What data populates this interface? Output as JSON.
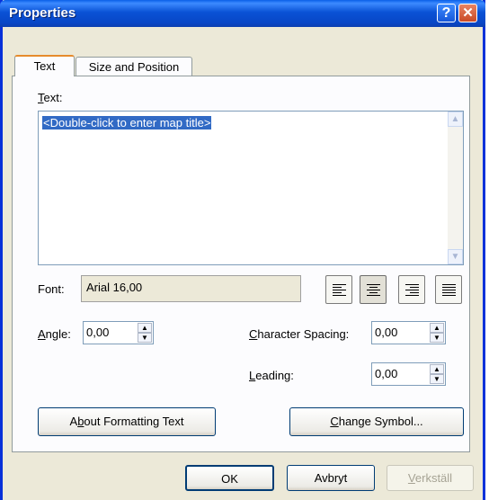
{
  "window": {
    "title": "Properties",
    "help_glyph": "?",
    "close_glyph": "✕"
  },
  "tabs": [
    {
      "label": "Text"
    },
    {
      "label": "Size and Position"
    }
  ],
  "text_section": {
    "label_underlined": "T",
    "label_rest": "ext:",
    "content": "<Double-click to enter map title>"
  },
  "font": {
    "label": "Font:",
    "value": "Arial 16,00"
  },
  "alignment": {
    "selected": "center",
    "options": [
      "left",
      "center",
      "right",
      "justify"
    ]
  },
  "angle": {
    "label_underlined": "A",
    "label_rest": "ngle:",
    "value": "0,00"
  },
  "character_spacing": {
    "label_underlined": "C",
    "label_rest": "haracter Spacing:",
    "value": "0,00"
  },
  "leading": {
    "label_underlined": "L",
    "label_rest": "eading:",
    "value": "0,00"
  },
  "buttons": {
    "about_pre": "A",
    "about_underlined": "b",
    "about_rest": "out Formatting Text",
    "change_underlined": "C",
    "change_rest": "hange Symbol...",
    "ok": "OK",
    "cancel": "Avbryt",
    "apply_underlined": "V",
    "apply_rest": "erkställ"
  }
}
